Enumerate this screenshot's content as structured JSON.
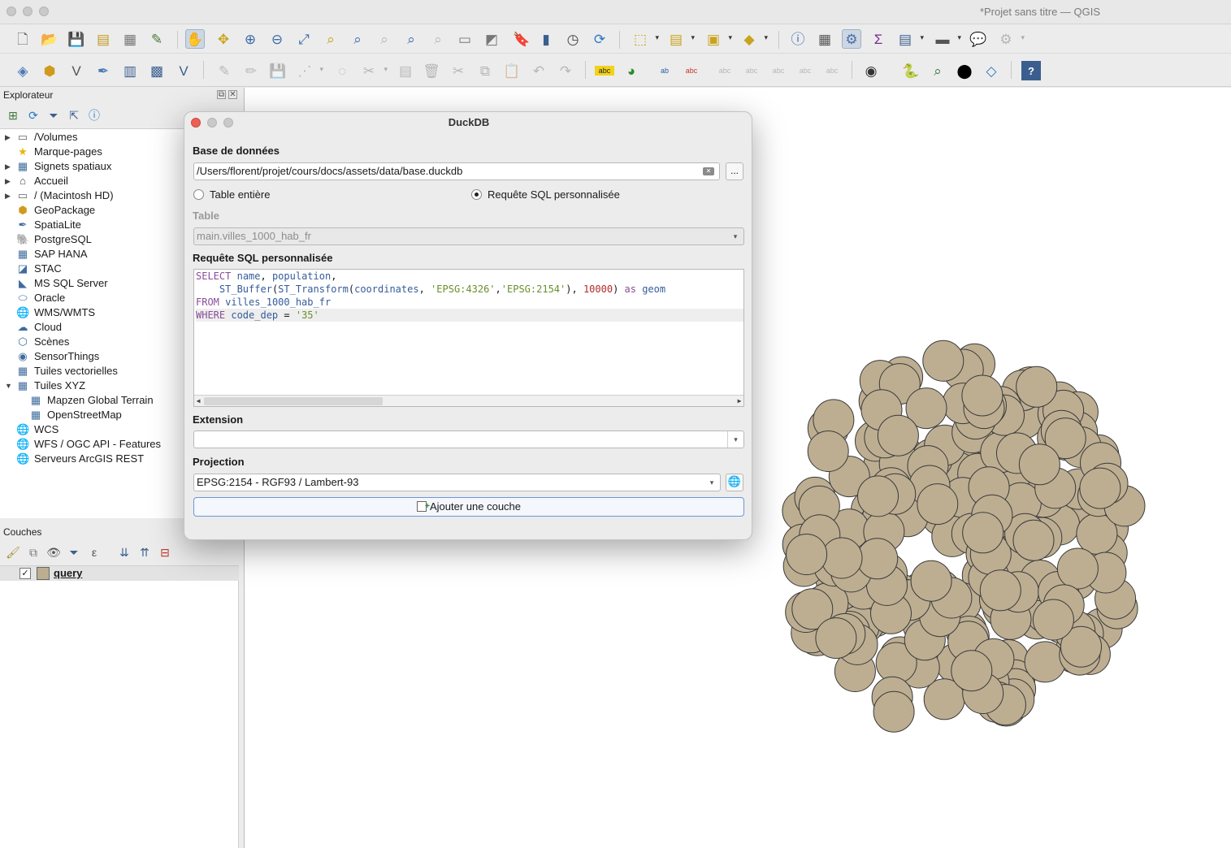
{
  "window": {
    "title": "*Projet sans titre — QGIS"
  },
  "toolbar1": [
    "new-project-icon",
    "open-project-icon",
    "save-project-icon",
    "print-layout-icon",
    "layout-manager-icon",
    "style-manager-icon",
    "pan-map-icon",
    "pan-to-selection-icon",
    "zoom-in-icon",
    "zoom-out-icon",
    "zoom-full-icon",
    "zoom-to-selection-icon",
    "zoom-to-layer-icon",
    "zoom-native-icon",
    "zoom-last-icon",
    "zoom-next-icon",
    "new-map-view-icon",
    "new-3d-view-icon",
    "new-bookmark-icon",
    "show-bookmarks-icon",
    "temporal-controller-icon",
    "refresh-icon",
    "select-features-icon",
    "select-by-value-icon",
    "deselect-icon",
    "select-location-icon",
    "identify-icon",
    "attribute-table-icon",
    "processing-toolbox-icon",
    "statistics-icon",
    "open-field-calculator-icon",
    "measure-icon",
    "annotation-icon",
    "map-tips-icon"
  ],
  "toolbar2": [
    "data-source-manager-icon",
    "new-geopackage-icon",
    "new-shapefile-icon",
    "new-spatialite-icon",
    "new-temp-layer-icon",
    "new-virtual-layer-icon",
    "new-mesh-icon",
    "edit-pencil-icon",
    "toggle-edit-icon",
    "save-edits-icon",
    "digitize-icon",
    "add-feature-icon",
    "vertex-tool-icon",
    "modify-attributes-icon",
    "delete-selected-icon",
    "cut-icon",
    "copy-icon",
    "paste-icon",
    "undo-icon",
    "redo-icon",
    "label-toolbar-icon",
    "diagram-icon",
    "highlight-label-icon",
    "pin-label-icon",
    "show-label-icon",
    "move-label-icon",
    "rotate-label-icon",
    "change-label-icon",
    "plugin-network-icon",
    "python-console-icon",
    "metasearch-icon",
    "duckdb-plugin-icon",
    "layer-styling-icon",
    "help-icon"
  ],
  "browser": {
    "title": "Explorateur",
    "items": [
      {
        "label": "/Volumes",
        "icon": "folder-icon",
        "expandable": true,
        "level": 0
      },
      {
        "label": "Marque-pages",
        "icon": "star-icon",
        "expandable": false,
        "level": 0
      },
      {
        "label": "Signets spatiaux",
        "icon": "bookmark-icon",
        "expandable": true,
        "level": 0
      },
      {
        "label": "Accueil",
        "icon": "home-icon",
        "expandable": true,
        "level": 0
      },
      {
        "label": "/ (Macintosh HD)",
        "icon": "folder-icon",
        "expandable": true,
        "level": 0
      },
      {
        "label": "GeoPackage",
        "icon": "geopackage-icon",
        "expandable": false,
        "level": 0
      },
      {
        "label": "SpatiaLite",
        "icon": "spatialite-icon",
        "expandable": false,
        "level": 0
      },
      {
        "label": "PostgreSQL",
        "icon": "postgresql-icon",
        "expandable": false,
        "level": 0
      },
      {
        "label": "SAP HANA",
        "icon": "sap-hana-icon",
        "expandable": false,
        "level": 0
      },
      {
        "label": "STAC",
        "icon": "stac-icon",
        "expandable": false,
        "level": 0
      },
      {
        "label": "MS SQL Server",
        "icon": "mssql-icon",
        "expandable": false,
        "level": 0
      },
      {
        "label": "Oracle",
        "icon": "oracle-icon",
        "expandable": false,
        "level": 0
      },
      {
        "label": "WMS/WMTS",
        "icon": "wms-icon",
        "expandable": false,
        "level": 0
      },
      {
        "label": "Cloud",
        "icon": "cloud-icon",
        "expandable": false,
        "level": 0
      },
      {
        "label": "Scènes",
        "icon": "scenes-icon",
        "expandable": false,
        "level": 0
      },
      {
        "label": "SensorThings",
        "icon": "sensor-icon",
        "expandable": false,
        "level": 0
      },
      {
        "label": "Tuiles vectorielles",
        "icon": "vector-tiles-icon",
        "expandable": false,
        "level": 0
      },
      {
        "label": "Tuiles XYZ",
        "icon": "xyz-tiles-icon",
        "expandable": true,
        "expanded": true,
        "level": 0
      },
      {
        "label": "Mapzen Global Terrain",
        "icon": "xyz-tiles-icon",
        "expandable": false,
        "level": 1
      },
      {
        "label": "OpenStreetMap",
        "icon": "xyz-tiles-icon",
        "expandable": false,
        "level": 1
      },
      {
        "label": "WCS",
        "icon": "wcs-icon",
        "expandable": false,
        "level": 0
      },
      {
        "label": "WFS / OGC API - Features",
        "icon": "wfs-icon",
        "expandable": false,
        "level": 0
      },
      {
        "label": "Serveurs ArcGIS REST",
        "icon": "arcgis-icon",
        "expandable": false,
        "level": 0
      }
    ]
  },
  "layers_panel": {
    "title": "Couches",
    "layers": [
      {
        "name": "query",
        "checked": true,
        "fill_color": "#bdae92"
      }
    ]
  },
  "dialog": {
    "title": "DuckDB",
    "database_label": "Base de données",
    "database_path": "/Users/florent/projet/cours/docs/assets/data/base.duckdb",
    "browse_label": "...",
    "radio_table_label": "Table entière",
    "radio_sql_label": "Requête SQL personnalisée",
    "selected_mode": "sql",
    "table_label": "Table",
    "table_value": "main.villes_1000_hab_fr",
    "sql_label": "Requête SQL personnalisée",
    "sql_lines": [
      "SELECT name, population,",
      "    ST_Buffer(ST_Transform(coordinates, 'EPSG:4326','EPSG:2154'), 10000) as geom",
      "FROM villes_1000_hab_fr",
      "WHERE code_dep = '35'"
    ],
    "extent_label": "Extension",
    "extent_value": "",
    "projection_label": "Projection",
    "projection_value": "EPSG:2154 - RGF93 / Lambert-93",
    "add_layer_label": "Ajouter une couche"
  },
  "map": {
    "fill_color": "#bdae92",
    "stroke_color": "#3a3a3a"
  }
}
